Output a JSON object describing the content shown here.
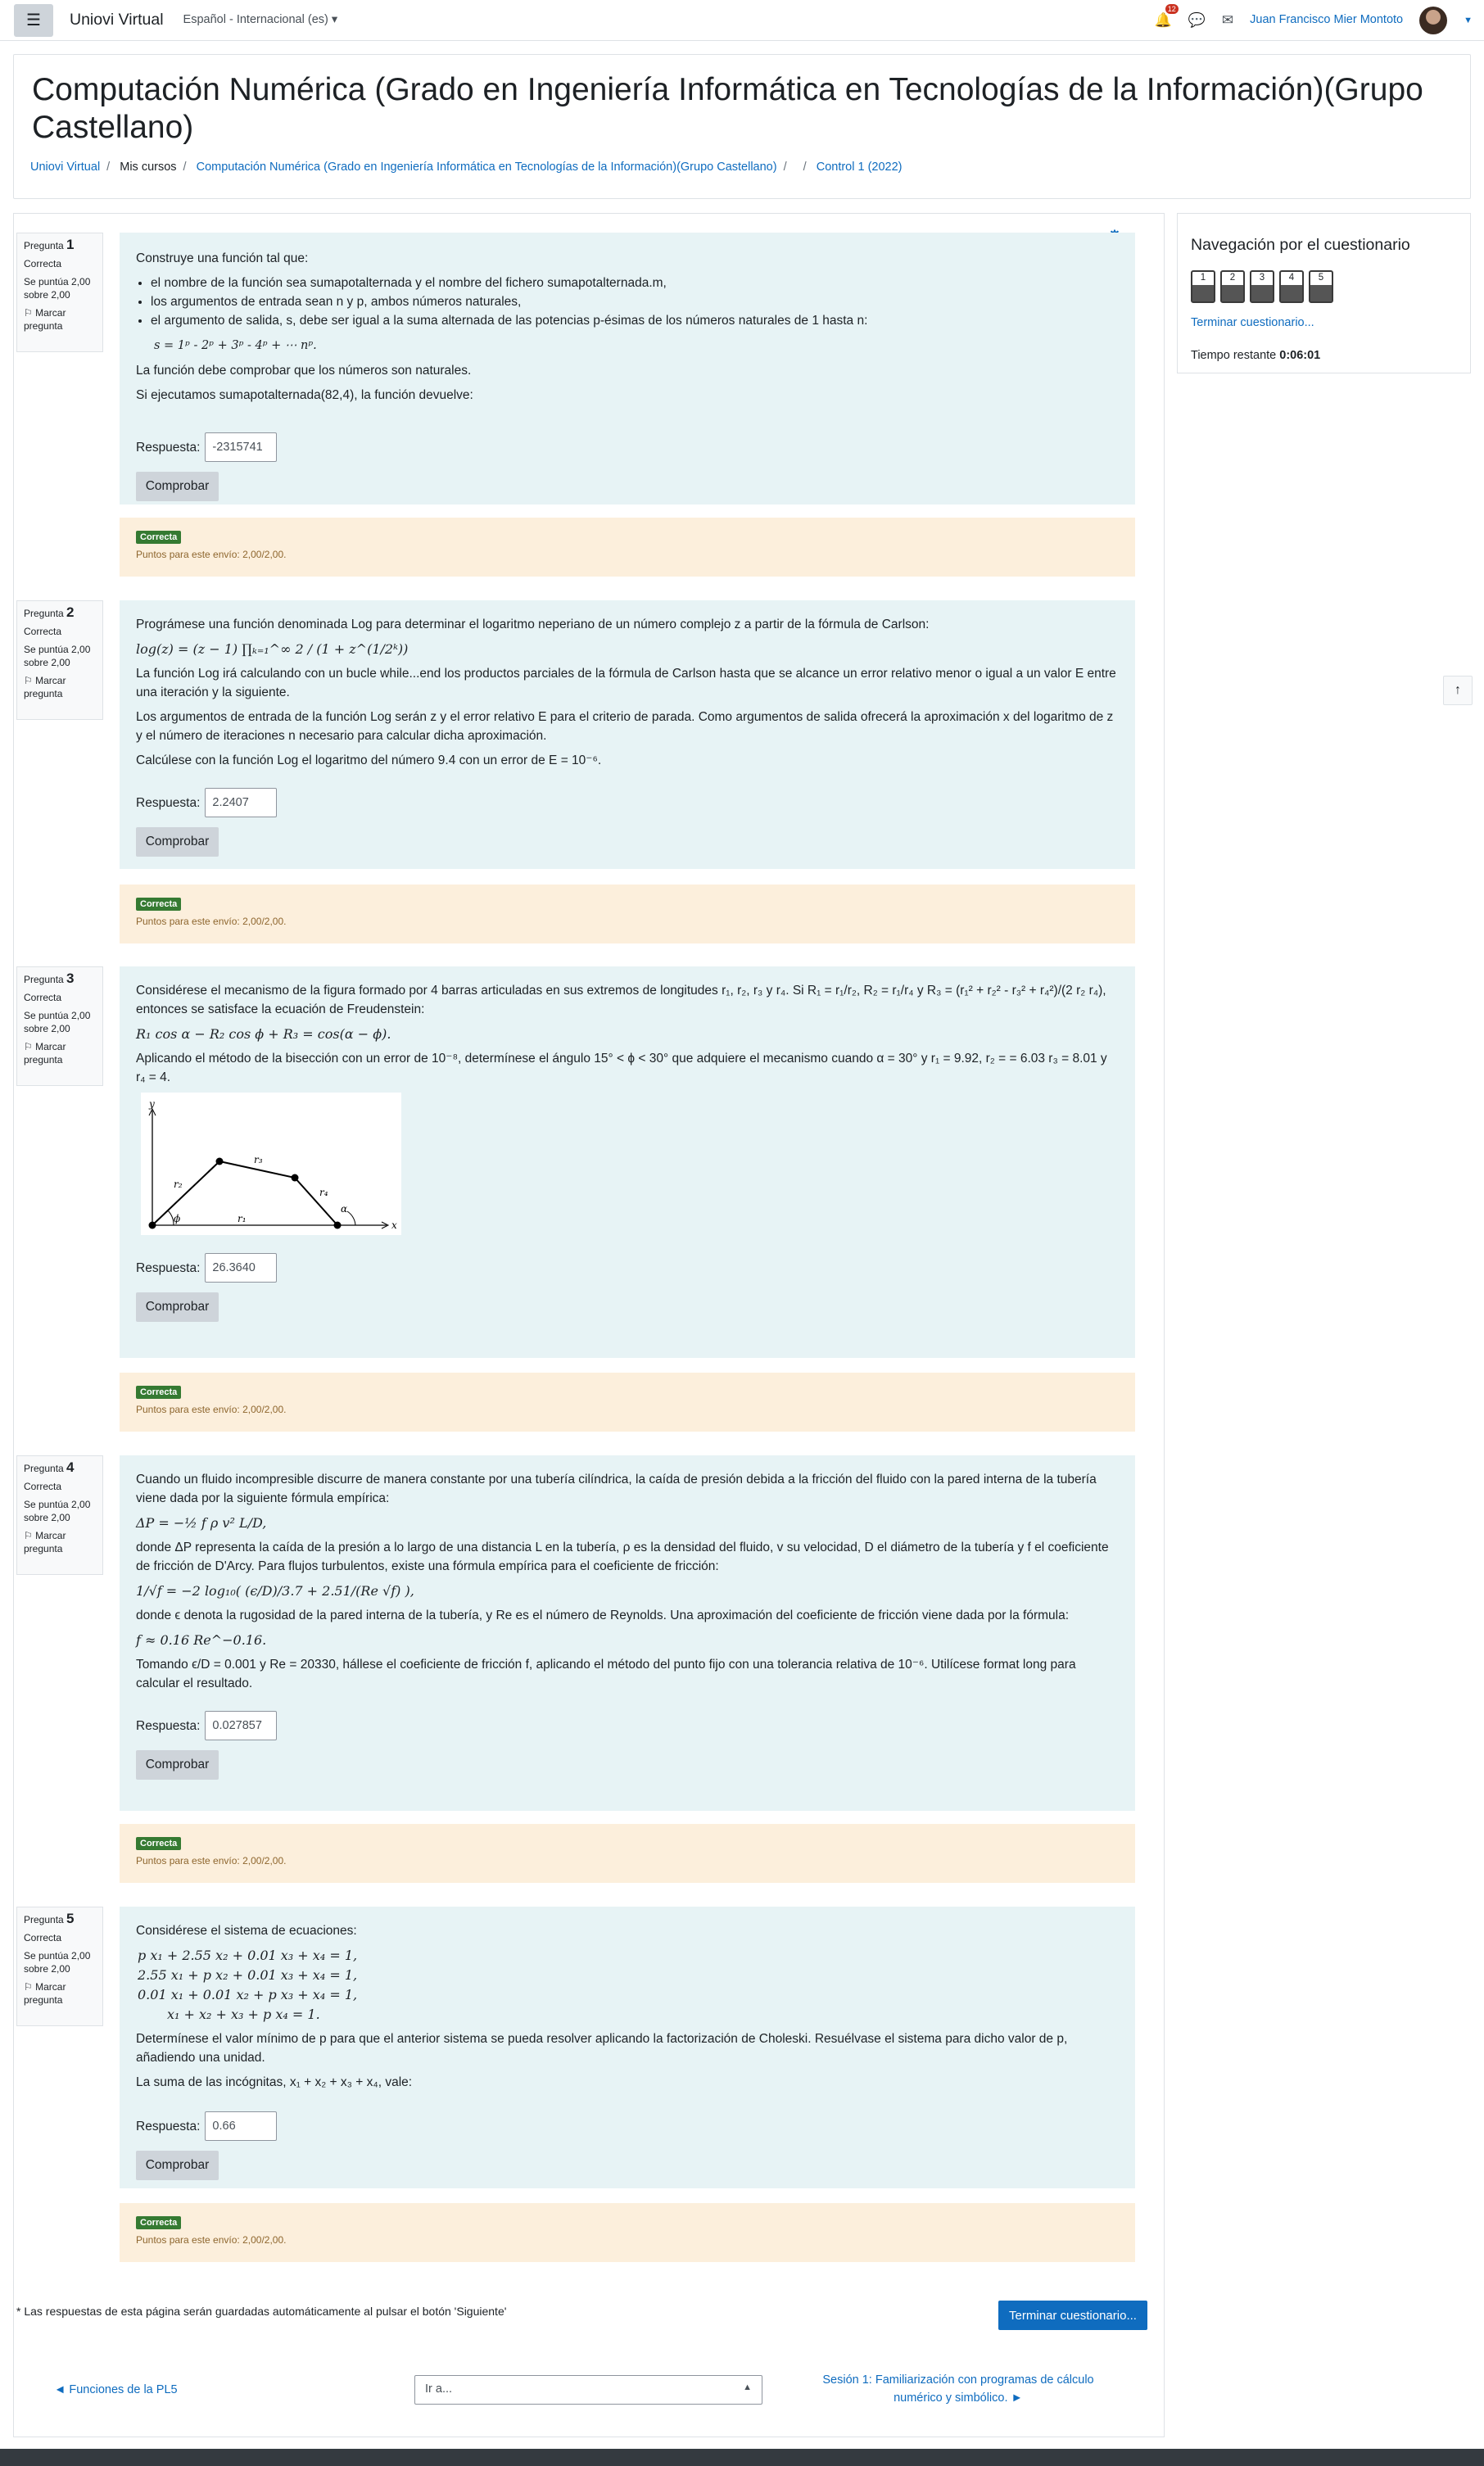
{
  "navbar": {
    "brand": "Uniovi Virtual",
    "language": "Español - Internacional (es)",
    "notif_count": "12",
    "user_name": "Juan Francisco Mier Montoto"
  },
  "header": {
    "title": "Computación Numérica (Grado en Ingeniería Informática en Tecnologías de la Información)(Grupo Castellano)",
    "breadcrumb": [
      "Uniovi Virtual",
      "Mis cursos",
      "Computación Numérica (Grado en Ingeniería Informática en Tecnologías de la Información)(Grupo Castellano)",
      "",
      "Control 1 (2022)"
    ]
  },
  "quiz_nav": {
    "title": "Navegación por el cuestionario",
    "buttons": [
      "1",
      "2",
      "3",
      "4",
      "5"
    ],
    "finish_link": "Terminar cuestionario...",
    "time_label": "Tiempo restante",
    "time_value": "0:06:01"
  },
  "common": {
    "status": "Correcta",
    "score": "Se puntúa 2,00 sobre 2,00",
    "flag": "Marcar pregunta",
    "answer_label": "Respuesta:",
    "check_label": "Comprobar",
    "feedback_badge": "Correcta",
    "feedback_points": "Puntos para este envío: 2,00/2,00.",
    "question_word": "Pregunta"
  },
  "questions": [
    {
      "number": "1",
      "answer": "-2315741",
      "intro": "Construye una función tal que:",
      "bullets": [
        "el nombre de la función sea sumapotalternada y el nombre del fichero sumapotalternada.m,",
        "los argumentos de entrada sean n y p, ambos números naturales,",
        "el argumento de salida, s, debe ser igual a la suma alternada de las potencias p-ésimas de los números naturales de 1 hasta n:"
      ],
      "formula": "s = 1ᵖ - 2ᵖ + 3ᵖ - 4ᵖ + ⋯ nᵖ.",
      "p1": "La función debe comprobar que los números son naturales.",
      "p2": "Si ejecutamos sumapotalternada(82,4), la función devuelve:"
    },
    {
      "number": "2",
      "answer": "2.2407",
      "p1": "Prográmese una función denominada Log para determinar el logaritmo neperiano de un número complejo z a partir de la fórmula de Carlson:",
      "formula": "log(z) = (z − 1) ∏ₖ₌₁^∞ 2 / (1 + z^(1/2ᵏ))",
      "p2": "La función Log irá calculando con un bucle while...end los productos parciales de la fórmula de Carlson hasta que se alcance un error relativo menor o igual a un valor E entre una iteración y la siguiente.",
      "p3": "Los argumentos de entrada de la función Log serán z y el error relativo E para el criterio de parada. Como argumentos de salida ofrecerá la aproximación x del logaritmo de z y el número de iteraciones n necesario para calcular dicha aproximación.",
      "p4": "Calcúlese con la función Log el logaritmo del número 9.4 con un error de E = 10⁻⁶."
    },
    {
      "number": "3",
      "answer": "26.3640",
      "p1": "Considérese el mecanismo de la figura formado por 4 barras articuladas en sus extremos de longitudes r₁, r₂, r₃ y r₄. Si R₁ = r₁/r₂, R₂ = r₁/r₄ y R₃ = (r₁² + r₂² - r₃² + r₄²)/(2 r₂ r₄), entonces se satisface la ecuación de Freudenstein:",
      "formula": "R₁ cos α − R₂ cos ϕ + R₃ = cos(α − ϕ).",
      "p2": "Aplicando el método de la bisección con un error de 10⁻⁸, determínese el ángulo 15° < ϕ < 30° que adquiere el mecanismo cuando α = 30° y r₁ = 9.92, r₂ = = 6.03 r₃ = 8.01 y r₄ = 4.",
      "fig_labels": {
        "y": "y",
        "x": "x",
        "r1": "r₁",
        "r2": "r₂",
        "r3": "r₃",
        "r4": "r₄",
        "phi": "ϕ",
        "alpha": "α"
      }
    },
    {
      "number": "4",
      "answer": "0.027857",
      "p1": "Cuando un fluido incompresible discurre de manera constante por una tubería cilíndrica, la caída de presión debida a la fricción del fluido con la pared interna de la tubería viene dada por la siguiente fórmula empírica:",
      "formula1": "ΔP = −½ f ρ v² L/D,",
      "p2": "donde ΔP representa la caída de la presión a lo largo de una distancia L en la tubería, ρ es la densidad del fluido, v su velocidad, D el diámetro de la tubería y f el coeficiente de fricción de D'Arcy. Para flujos turbulentos, existe una fórmula empírica para el coeficiente de fricción:",
      "formula2": "1/√f = −2 log₁₀( (ϵ/D)/3.7 + 2.51/(Re √f) ),",
      "p3": "donde ϵ denota la rugosidad de la pared interna de la tubería, y Re es el número de Reynolds. Una aproximación del coeficiente de fricción viene dada por la fórmula:",
      "formula3": "f ≈ 0.16 Re^−0.16.",
      "p4": "Tomando ϵ/D = 0.001 y Re = 20330, hállese el coeficiente de fricción f, aplicando el método del punto fijo con una tolerancia relativa de 10⁻⁶. Utilícese format long para calcular el resultado."
    },
    {
      "number": "5",
      "answer": "0.66",
      "p1": "Considérese el sistema de ecuaciones:",
      "eqs": [
        "p x₁ + 2.55 x₂ + 0.01 x₃ + x₄ = 1,",
        "2.55 x₁ + p x₂ + 0.01 x₃ + x₄ = 1,",
        "0.01 x₁ + 0.01 x₂ + p x₃ + x₄ = 1,",
        "x₁ + x₂ + x₃ + p x₄ = 1."
      ],
      "p2": "Determínese el valor mínimo de p para que el anterior sistema se pueda resolver aplicando la factorización de Choleski. Resuélvase el sistema para dicho valor de p, añadiendo una unidad.",
      "p3": "La suma de las incógnitas, x₁ + x₂ + x₃ + x₄, vale:"
    }
  ],
  "footer": {
    "note": "* Las respuestas de esta página serán guardadas automáticamente al pulsar el botón 'Siguiente'",
    "finish_button": "Terminar cuestionario...",
    "prev_link": "◄ Funciones de la PL5",
    "jump_placeholder": "Ir a...",
    "next_link": "Sesión 1: Familiarización con programas de cálculo numérico y simbólico. ►"
  },
  "colors": {
    "accent": "#0f6cbf",
    "question_bg": "#e7f3f5",
    "feedback_bg": "#fcefdc",
    "correct_badge": "#357a32"
  },
  "icons": {
    "menu": "hamburger-icon",
    "notifications": "bell-icon",
    "messages": "chat-icon",
    "mail": "envelope-icon",
    "settings": "gear-icon",
    "flag": "flag-icon",
    "back_to_top": "arrow-up-icon"
  }
}
